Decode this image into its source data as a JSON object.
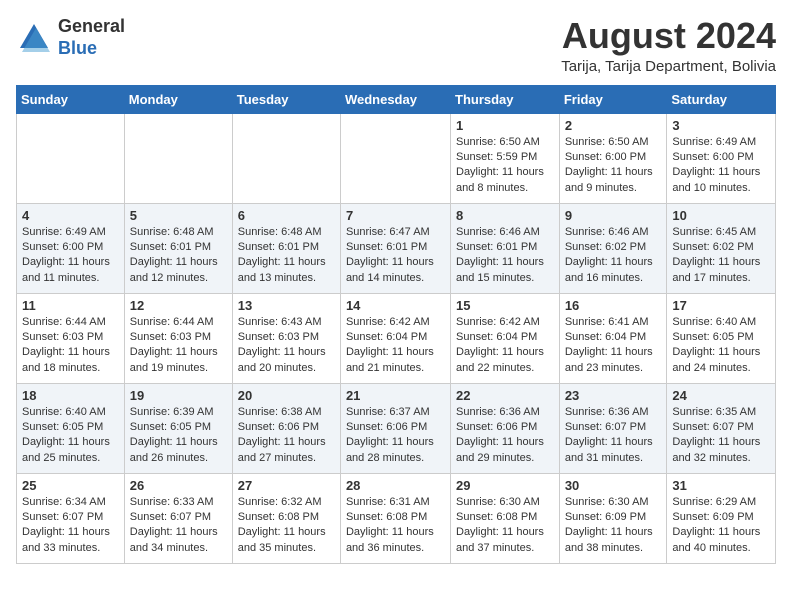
{
  "header": {
    "logo_general": "General",
    "logo_blue": "Blue",
    "month_year": "August 2024",
    "location": "Tarija, Tarija Department, Bolivia"
  },
  "weekdays": [
    "Sunday",
    "Monday",
    "Tuesday",
    "Wednesday",
    "Thursday",
    "Friday",
    "Saturday"
  ],
  "weeks": [
    [
      {
        "day": "",
        "info": ""
      },
      {
        "day": "",
        "info": ""
      },
      {
        "day": "",
        "info": ""
      },
      {
        "day": "",
        "info": ""
      },
      {
        "day": "1",
        "info": "Sunrise: 6:50 AM\nSunset: 5:59 PM\nDaylight: 11 hours\nand 8 minutes."
      },
      {
        "day": "2",
        "info": "Sunrise: 6:50 AM\nSunset: 6:00 PM\nDaylight: 11 hours\nand 9 minutes."
      },
      {
        "day": "3",
        "info": "Sunrise: 6:49 AM\nSunset: 6:00 PM\nDaylight: 11 hours\nand 10 minutes."
      }
    ],
    [
      {
        "day": "4",
        "info": "Sunrise: 6:49 AM\nSunset: 6:00 PM\nDaylight: 11 hours\nand 11 minutes."
      },
      {
        "day": "5",
        "info": "Sunrise: 6:48 AM\nSunset: 6:01 PM\nDaylight: 11 hours\nand 12 minutes."
      },
      {
        "day": "6",
        "info": "Sunrise: 6:48 AM\nSunset: 6:01 PM\nDaylight: 11 hours\nand 13 minutes."
      },
      {
        "day": "7",
        "info": "Sunrise: 6:47 AM\nSunset: 6:01 PM\nDaylight: 11 hours\nand 14 minutes."
      },
      {
        "day": "8",
        "info": "Sunrise: 6:46 AM\nSunset: 6:01 PM\nDaylight: 11 hours\nand 15 minutes."
      },
      {
        "day": "9",
        "info": "Sunrise: 6:46 AM\nSunset: 6:02 PM\nDaylight: 11 hours\nand 16 minutes."
      },
      {
        "day": "10",
        "info": "Sunrise: 6:45 AM\nSunset: 6:02 PM\nDaylight: 11 hours\nand 17 minutes."
      }
    ],
    [
      {
        "day": "11",
        "info": "Sunrise: 6:44 AM\nSunset: 6:03 PM\nDaylight: 11 hours\nand 18 minutes."
      },
      {
        "day": "12",
        "info": "Sunrise: 6:44 AM\nSunset: 6:03 PM\nDaylight: 11 hours\nand 19 minutes."
      },
      {
        "day": "13",
        "info": "Sunrise: 6:43 AM\nSunset: 6:03 PM\nDaylight: 11 hours\nand 20 minutes."
      },
      {
        "day": "14",
        "info": "Sunrise: 6:42 AM\nSunset: 6:04 PM\nDaylight: 11 hours\nand 21 minutes."
      },
      {
        "day": "15",
        "info": "Sunrise: 6:42 AM\nSunset: 6:04 PM\nDaylight: 11 hours\nand 22 minutes."
      },
      {
        "day": "16",
        "info": "Sunrise: 6:41 AM\nSunset: 6:04 PM\nDaylight: 11 hours\nand 23 minutes."
      },
      {
        "day": "17",
        "info": "Sunrise: 6:40 AM\nSunset: 6:05 PM\nDaylight: 11 hours\nand 24 minutes."
      }
    ],
    [
      {
        "day": "18",
        "info": "Sunrise: 6:40 AM\nSunset: 6:05 PM\nDaylight: 11 hours\nand 25 minutes."
      },
      {
        "day": "19",
        "info": "Sunrise: 6:39 AM\nSunset: 6:05 PM\nDaylight: 11 hours\nand 26 minutes."
      },
      {
        "day": "20",
        "info": "Sunrise: 6:38 AM\nSunset: 6:06 PM\nDaylight: 11 hours\nand 27 minutes."
      },
      {
        "day": "21",
        "info": "Sunrise: 6:37 AM\nSunset: 6:06 PM\nDaylight: 11 hours\nand 28 minutes."
      },
      {
        "day": "22",
        "info": "Sunrise: 6:36 AM\nSunset: 6:06 PM\nDaylight: 11 hours\nand 29 minutes."
      },
      {
        "day": "23",
        "info": "Sunrise: 6:36 AM\nSunset: 6:07 PM\nDaylight: 11 hours\nand 31 minutes."
      },
      {
        "day": "24",
        "info": "Sunrise: 6:35 AM\nSunset: 6:07 PM\nDaylight: 11 hours\nand 32 minutes."
      }
    ],
    [
      {
        "day": "25",
        "info": "Sunrise: 6:34 AM\nSunset: 6:07 PM\nDaylight: 11 hours\nand 33 minutes."
      },
      {
        "day": "26",
        "info": "Sunrise: 6:33 AM\nSunset: 6:07 PM\nDaylight: 11 hours\nand 34 minutes."
      },
      {
        "day": "27",
        "info": "Sunrise: 6:32 AM\nSunset: 6:08 PM\nDaylight: 11 hours\nand 35 minutes."
      },
      {
        "day": "28",
        "info": "Sunrise: 6:31 AM\nSunset: 6:08 PM\nDaylight: 11 hours\nand 36 minutes."
      },
      {
        "day": "29",
        "info": "Sunrise: 6:30 AM\nSunset: 6:08 PM\nDaylight: 11 hours\nand 37 minutes."
      },
      {
        "day": "30",
        "info": "Sunrise: 6:30 AM\nSunset: 6:09 PM\nDaylight: 11 hours\nand 38 minutes."
      },
      {
        "day": "31",
        "info": "Sunrise: 6:29 AM\nSunset: 6:09 PM\nDaylight: 11 hours\nand 40 minutes."
      }
    ]
  ]
}
